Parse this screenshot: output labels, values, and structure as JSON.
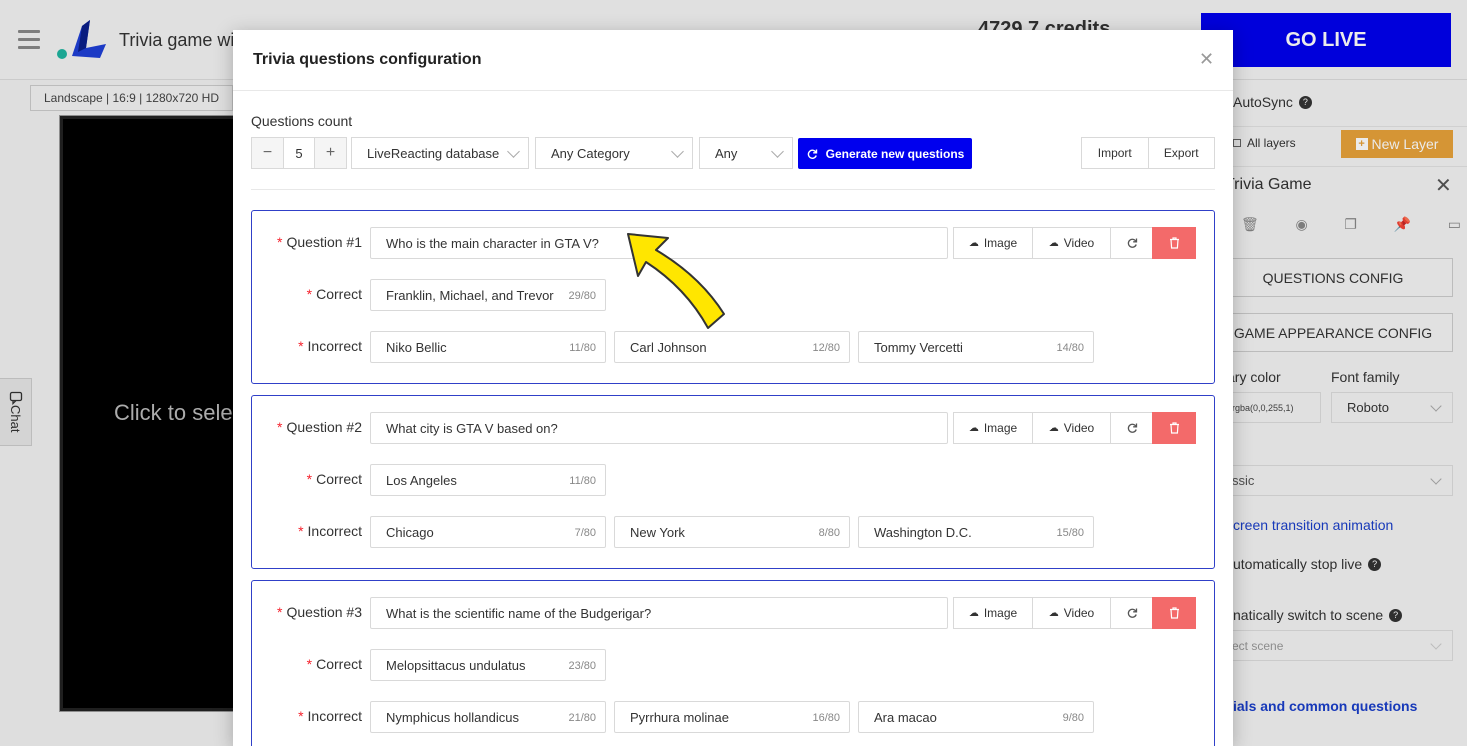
{
  "app": {
    "title": "Trivia game wi",
    "credits": "4729.7 credits",
    "go_live": "GO LIVE",
    "canvas_tag": "Landscape | 16:9 | 1280x720 HD",
    "stage_hint": "Click to sele",
    "chat_tab": "Chat"
  },
  "right_panel": {
    "autosync": "AutoSync",
    "all_layers": "All layers",
    "new_layer": "New Layer",
    "layer_title": "Trivia Game",
    "questions_config": "QUESTIONS CONFIG",
    "game_appearance_config": "GAME APPEARANCE CONFIG",
    "primary_color_label": "ary color",
    "primary_color_value": "rgba(0,0,255,1)",
    "font_family_label": "Font family",
    "font_family_value": "Roboto",
    "theme_value": "ssic",
    "transition_link": "creen transition animation",
    "auto_stop": "utomatically stop live",
    "auto_switch": "natically switch to scene",
    "select_scene_placeholder": "ect scene",
    "tutorials_link": "ials and common questions"
  },
  "modal": {
    "title": "Trivia questions configuration",
    "questions_count_label": "Questions count",
    "questions_count": "5",
    "source_select": "LiveReacting database",
    "category_select": "Any Category",
    "difficulty_select": "Any",
    "generate_button": "Generate new questions",
    "import_button": "Import",
    "export_button": "Export",
    "labels": {
      "correct": "Correct",
      "incorrect": "Incorrect",
      "image": "Image",
      "video": "Video"
    },
    "questions": [
      {
        "label": "Question #1",
        "text": "Who is the main character in GTA V?",
        "correct": {
          "text": "Franklin, Michael, and Trevor",
          "count": "29/80"
        },
        "incorrect": [
          {
            "text": "Niko Bellic",
            "count": "11/80"
          },
          {
            "text": "Carl Johnson",
            "count": "12/80"
          },
          {
            "text": "Tommy Vercetti",
            "count": "14/80"
          }
        ]
      },
      {
        "label": "Question #2",
        "text": "What city is GTA V based on?",
        "correct": {
          "text": "Los Angeles",
          "count": "11/80"
        },
        "incorrect": [
          {
            "text": "Chicago",
            "count": "7/80"
          },
          {
            "text": "New York",
            "count": "8/80"
          },
          {
            "text": "Washington D.C.",
            "count": "15/80"
          }
        ]
      },
      {
        "label": "Question #3",
        "text": "What is the scientific name of the Budgerigar?",
        "correct": {
          "text": "Melopsittacus undulatus",
          "count": "23/80"
        },
        "incorrect": [
          {
            "text": "Nymphicus hollandicus",
            "count": "21/80"
          },
          {
            "text": "Pyrrhura molinae",
            "count": "16/80"
          },
          {
            "text": "Ara macao",
            "count": "9/80"
          }
        ]
      }
    ]
  },
  "colors": {
    "primary": "#0000ee",
    "card_border": "#3040c8",
    "delete": "#f36a6a",
    "new_layer": "#e8a23a",
    "required": "#f5222d"
  }
}
